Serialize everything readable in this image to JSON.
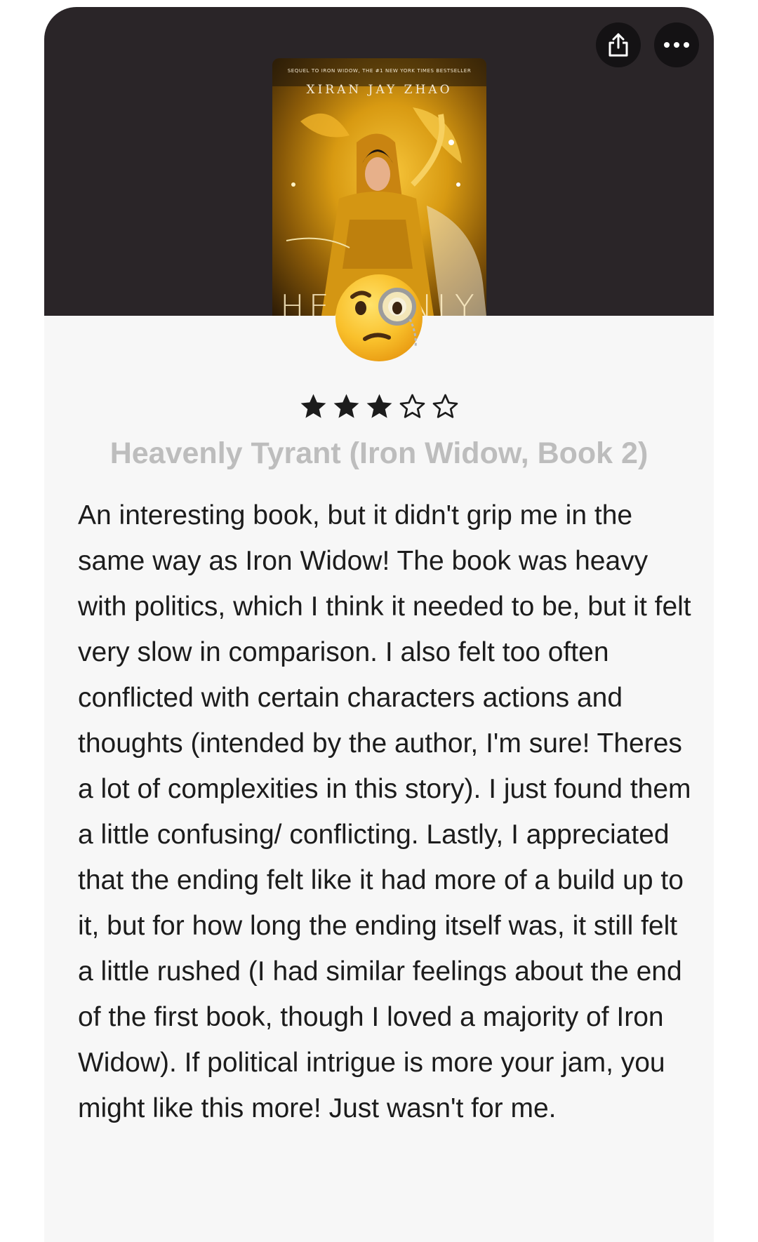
{
  "cover": {
    "tagline": "SEQUEL TO IRON WIDOW, THE #1 NEW YORK TIMES BESTSELLER",
    "author": "XIRAN JAY ZHAO",
    "title_partial": "HEAVENLY"
  },
  "actions": {
    "share_icon": "share-icon",
    "more_icon": "more-icon"
  },
  "reaction": {
    "emoji": "face-with-monocle"
  },
  "rating": {
    "value": 3,
    "max": 5
  },
  "book": {
    "title": "Heavenly Tyrant (Iron Widow, Book 2)"
  },
  "review": {
    "text": "An interesting book, but it didn't grip me in the same way as Iron Widow! The book was heavy with politics, which I think it needed to be, but it felt very slow in comparison. I also felt too often conflicted with certain characters actions and thoughts (intended by the author, I'm sure! Theres a lot of complexities in this story). I just found them a little confusing/ conflicting. Lastly, I appreciated that the ending felt like it had more of a build up to it, but for how long the ending itself was, it still felt a little rushed (I had similar feelings about the end of the first book, though I loved a majority of Iron Widow). If political intrigue is more your jam, you might like this more! Just wasn't for me."
  }
}
